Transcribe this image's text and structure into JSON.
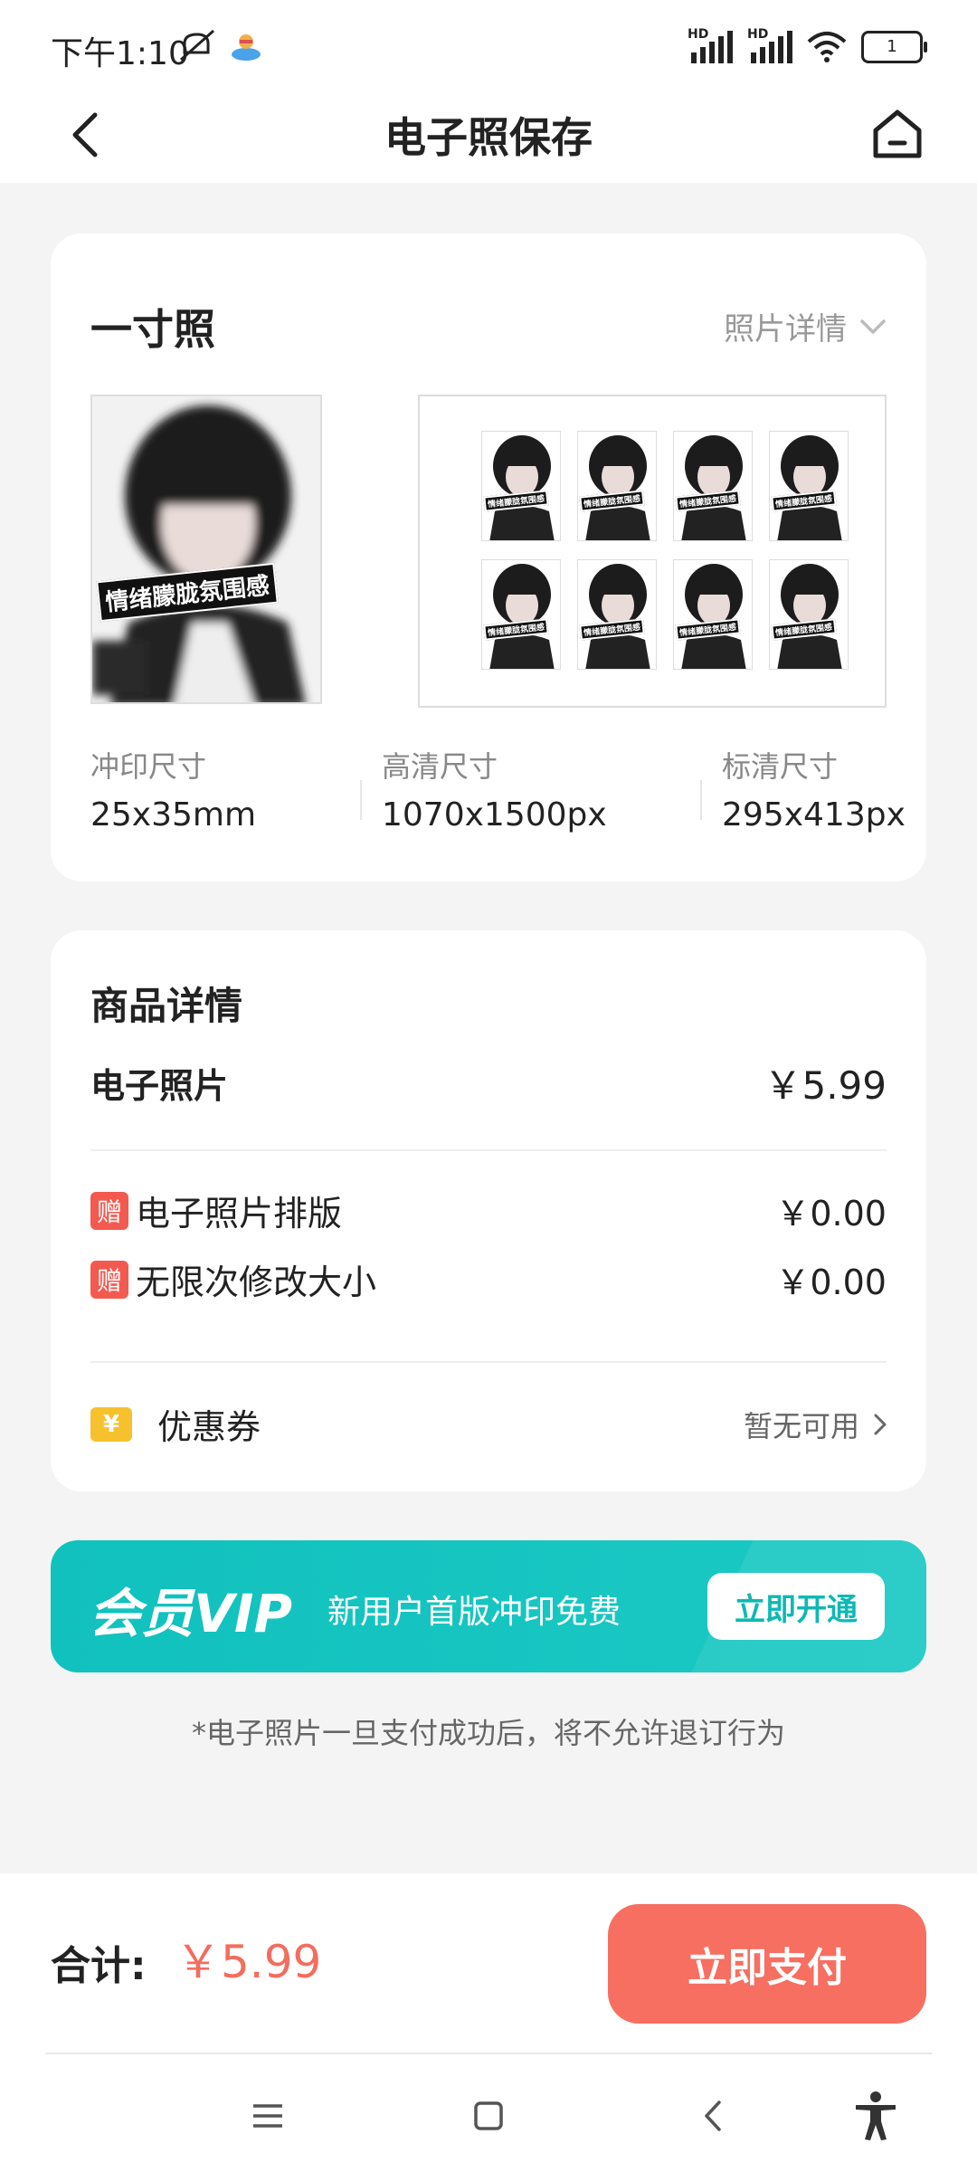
{
  "status_bar": {
    "time": "下午1:10",
    "hd_label": "HD",
    "battery": "1"
  },
  "header": {
    "title": "电子照保存"
  },
  "photo_card": {
    "title": "一寸照",
    "detail_label": "照片详情",
    "sticker_text": "情绪朦胧氛围感",
    "specs": [
      {
        "label": "冲印尺寸",
        "value": "25x35mm"
      },
      {
        "label": "高清尺寸",
        "value": "1070x1500px"
      },
      {
        "label": "标清尺寸",
        "value": "295x413px"
      }
    ]
  },
  "product": {
    "title": "商品详情",
    "main_item": {
      "name": "电子照片",
      "price": "￥5.99"
    },
    "gifts": [
      {
        "badge": "赠",
        "name": "电子照片排版",
        "price": "￥0.00"
      },
      {
        "badge": "赠",
        "name": "无限次修改大小",
        "price": "￥0.00"
      }
    ],
    "coupon": {
      "icon_text": "¥",
      "label": "优惠券",
      "status": "暂无可用"
    }
  },
  "vip": {
    "logo": "会员VIP",
    "text": "新用户首版冲印免费",
    "button": "立即开通"
  },
  "notice": "*电子照片一旦支付成功后，将不允许退订行为",
  "checkout": {
    "total_label": "合计:",
    "total_value": "￥5.99",
    "pay_button": "立即支付"
  },
  "colors": {
    "accent_red": "#f66f61",
    "vip_teal": "#11c1bd",
    "gift_badge": "#f25a50",
    "coupon_yellow": "#f7c12e"
  },
  "icons": [
    "back-arrow-icon",
    "home-icon",
    "chevron-down-icon",
    "chevron-right-icon",
    "menu-icon",
    "square-icon",
    "nav-back-icon",
    "accessibility-icon",
    "mute-icon",
    "wifi-icon"
  ]
}
